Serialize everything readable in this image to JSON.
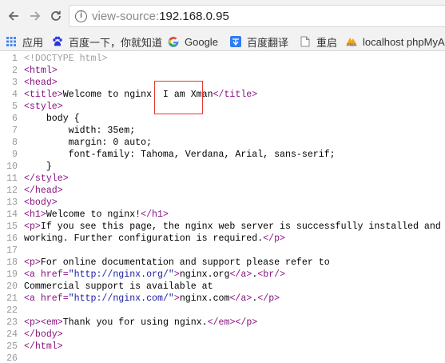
{
  "address_bar": {
    "scheme": "view-source:",
    "host": "192.168.0.95"
  },
  "bookmarks": [
    {
      "label": "应用",
      "icon": "apps-grid-icon"
    },
    {
      "label": "百度一下，你就知道",
      "icon": "baidu-paw-icon"
    },
    {
      "label": "Google",
      "icon": "google-g-icon"
    },
    {
      "label": "百度翻译",
      "icon": "fanyi-icon"
    },
    {
      "label": "重启",
      "icon": "page-icon"
    },
    {
      "label": "localhost phpMyA",
      "icon": "phpmyadmin-icon"
    }
  ],
  "source_lines": [
    "1",
    "2",
    "3",
    "4",
    "5",
    "6",
    "7",
    "8",
    "9",
    "10",
    "11",
    "12",
    "13",
    "14",
    "15",
    "16",
    "17",
    "18",
    "19",
    "20",
    "21",
    "22",
    "23",
    "24",
    "25",
    "26"
  ],
  "source": {
    "l1": "<!DOCTYPE html>",
    "html_open": "<html>",
    "head_open": "<head>",
    "title_open": "<title>",
    "title_text": "Welcome to nginx! I am Xman",
    "title_close": "</title>",
    "style_open": "<style>",
    "l6": "    body {",
    "l7": "        width: 35em;",
    "l8": "        margin: 0 auto;",
    "l9": "        font-family: Tahoma, Verdana, Arial, sans-serif;",
    "l10": "    }",
    "style_close": "</style>",
    "head_close": "</head>",
    "body_open": "<body>",
    "h1_open": "<h1>",
    "h1_text": "Welcome to nginx!",
    "h1_close": "</h1>",
    "p_open": "<p>",
    "l15_text": "If you see this page, the nginx web server is successfully installed and",
    "l16_text": "working. Further configuration is required.",
    "p_close": "</p>",
    "l18_text": "For online documentation and support please refer to",
    "a_open_start": "<a ",
    "href_attr": "href=",
    "href_org": "\"http://nginx.org/\"",
    "tag_gt": ">",
    "org_text": "nginx.org",
    "a_close": "</a>",
    "dot": ".",
    "br": "<br/>",
    "l20_text": "Commercial support is available at",
    "href_com": "\"http://nginx.com/\"",
    "com_text": "nginx.com",
    "em_open": "<em>",
    "l25_text": "Thank you for using nginx.",
    "em_close": "</em>",
    "body_close": "</body>",
    "html_close": "</html>"
  }
}
